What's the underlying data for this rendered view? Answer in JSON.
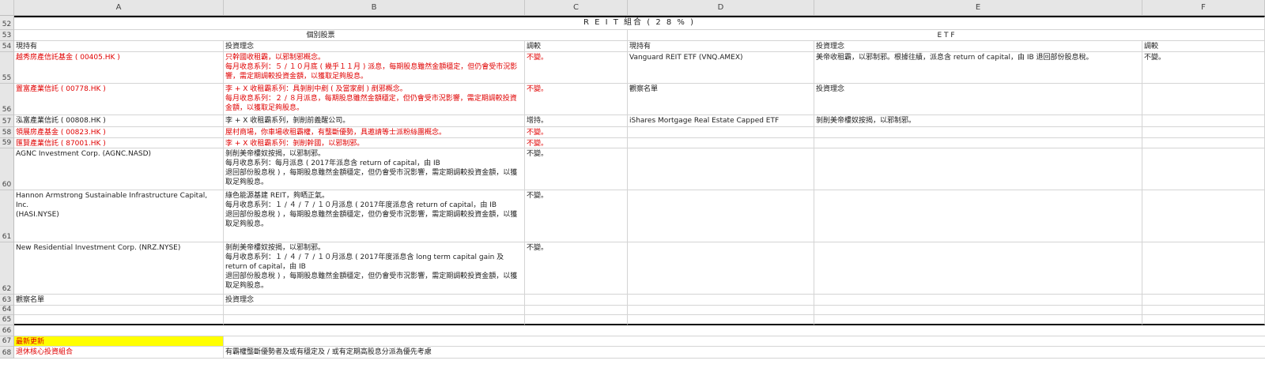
{
  "columns": [
    "A",
    "B",
    "C",
    "D",
    "E",
    "F"
  ],
  "rows": [
    "52",
    "53",
    "54",
    "55",
    "56",
    "57",
    "58",
    "59",
    "60",
    "61",
    "62",
    "63",
    "64",
    "65",
    "66",
    "67",
    "68"
  ],
  "r52": {
    "title": "R E I T 組合 ( 2 8 % )"
  },
  "r53": {
    "stocks": "個別股票",
    "etf": "E T F"
  },
  "r54": {
    "a": "現持有",
    "b": "投資理念",
    "c": "調較",
    "d": "現持有",
    "e": "投資理念",
    "f": "調較"
  },
  "r55": {
    "a": "越秀房產信託基金 ( 00405.HK )",
    "b": "只幹國收租霸，以邪制邪概念。\n每月收息系列：５ / １０月底 ( 幾乎１１月 ) 派息，每期股息雖然金額穩定，但仍會受市況影響，需定期調較投資金額，以獲取足夠股息。",
    "c": "不變。",
    "d": "Vanguard REIT ETF (VNQ.AMEX)",
    "e": "美帝收租霸，以邪制邪。根據往績，派息含 return of capital，由 IB 退回部份股息稅。",
    "f": "不變。"
  },
  "r56": {
    "a": "置富產業信託 ( 00778.HK )",
    "b": "李 + X 收租霸系列：具剝削中剷 ( 及當家剷 ) 剷邪概念。\n每月收息系列：２ / ８月派息，每期股息雖然金額穩定，但仍會受市況影響，需定期調較投資金額，以獲取足夠股息。",
    "c": "不變。",
    "d": "觀察名單",
    "e": "投資理念"
  },
  "r57": {
    "a": "泓富產業信託 ( 00808.HK )",
    "b": "李 + X 收租霸系列，剝削前義醒公司。",
    "c": "增持。",
    "d": "iShares Mortgage Real Estate Capped ETF (REM.AMEX)",
    "e": "剝削美帝樓奴按揭，以邪制邪。"
  },
  "r58": {
    "a": "領展房產基金 ( 00823.HK )",
    "b": "屋村商場，你車場收租霸權，有壟斷優勢，具邀請等士派粉絲團概念。",
    "c": "不變。"
  },
  "r59": {
    "a": "匯賢產業信託 ( 87001.HK )",
    "b": "李 + X 收租霸系列：剝削幹國，以邪制邪。",
    "c": "不變。"
  },
  "r60": {
    "a": "AGNC Investment Corp. (AGNC.NASD)",
    "b": "剝削美帝樓奴按揭，以邪制邪。\n每月收息系列：每月派息 ( 2017年派息含 return of capital，由 IB\n退回部份股息稅 ) ，每期股息雖然金額穩定，但仍會受市況影響，需定期調較投資金額，以獲取足夠股息。",
    "c": "不變。"
  },
  "r61": {
    "a": "Hannon Armstrong Sustainable Infrastructure Capital, Inc.\n(HASI.NYSE)",
    "b": "綠色能源基建 REIT，夠晒正氣。\n每月收息系列：１ / ４ / ７ / １０月派息 ( 2017年度派息含 return of capital，由 IB\n退回部份股息稅 ) ，每期股息雖然金額穩定，但仍會受市況影響，需定期調較投資金額，以獲取足夠股息。",
    "c": "不變。"
  },
  "r62": {
    "a": "New Residential Investment Corp. (NRZ.NYSE)",
    "b": "剝削美帝樓奴按揭，以邪制邪。\n每月收息系列：１ / ４ / ７ / １０月派息 ( 2017年度派息含 long term capital gain 及 return of capital，由 IB\n退回部份股息稅 ) ，每期股息雖然金額穩定，但仍會受市況影響，需定期調較投資金額，以獲取足夠股息。",
    "c": "不變。"
  },
  "r63": {
    "a": "觀察名單",
    "b": "投資理念"
  },
  "r67": {
    "a": "最新更新"
  },
  "r68": {
    "a": "退休核心投資組合",
    "b": "有霸權壟斷優勢者及或有穩定及 / 或有定期高股息分派為優先考慮"
  },
  "colors": {
    "red_text": "#e00000",
    "highlight": "#ffff00",
    "header_bg": "#e6e6e6"
  }
}
